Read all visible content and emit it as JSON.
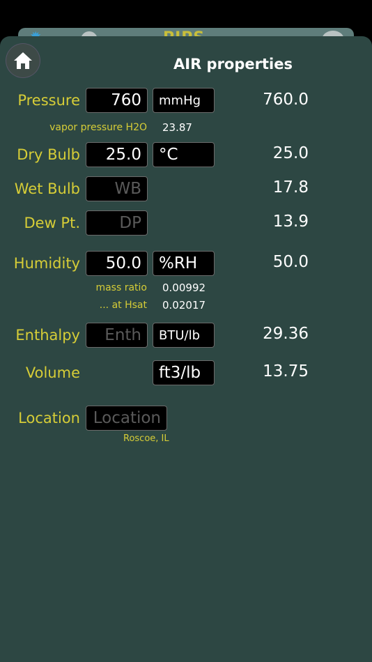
{
  "header_peek": {
    "title": "PIPS"
  },
  "screen": {
    "title": "AIR properties"
  },
  "rows": {
    "pressure": {
      "label": "Pressure",
      "input": "760",
      "unit": "mmHg",
      "result": "760.0"
    },
    "vapor": {
      "label": "vapor pressure H2O",
      "value": "23.87"
    },
    "drybulb": {
      "label": "Dry Bulb",
      "input": "25.0",
      "unit": "°C",
      "result": "25.0"
    },
    "wetbulb": {
      "label": "Wet Bulb",
      "placeholder": "WB",
      "result": "17.8"
    },
    "dewpt": {
      "label": "Dew Pt.",
      "placeholder": "DP",
      "result": "13.9"
    },
    "humidity": {
      "label": "Humidity",
      "input": "50.0",
      "unit": "%RH",
      "result": "50.0"
    },
    "mass_ratio": {
      "label": "mass ratio",
      "value": "0.00992"
    },
    "hsat": {
      "label": "... at Hsat",
      "value": "0.02017"
    },
    "enthalpy": {
      "label": "Enthalpy",
      "placeholder": "Enth",
      "unit": "BTU/lb",
      "result": "29.36"
    },
    "volume": {
      "label": "Volume",
      "unit": "ft3/lb",
      "result": "13.75"
    },
    "location": {
      "label": "Location",
      "placeholder": "Location",
      "value": "Roscoe, IL"
    }
  }
}
